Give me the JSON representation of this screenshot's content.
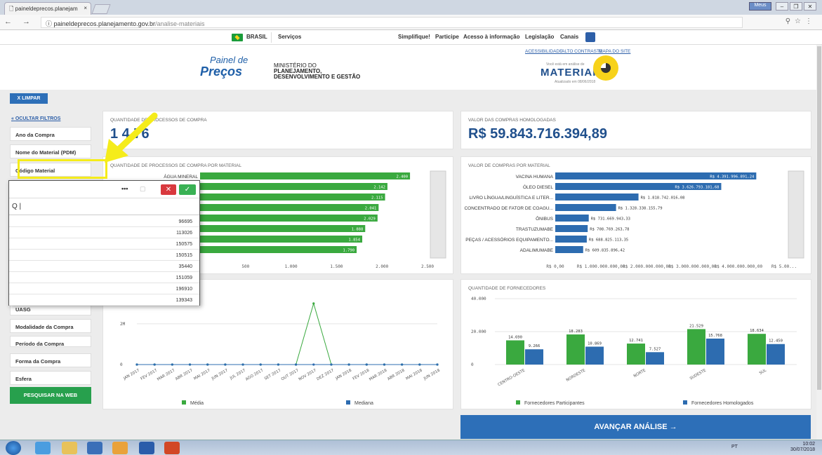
{
  "browser": {
    "tab_title": "paineldeprecos.planejam",
    "tab_close": "×",
    "url_host": "paineldeprecos.planejamento.gov.br",
    "url_path": "/analise-materiais",
    "profile": "Meus"
  },
  "govbar": {
    "brasil": "BRASIL",
    "servicos": "Serviços",
    "simplifique": "Simplifique!",
    "participe": "Participe",
    "acesso": "Acesso à informação",
    "legislacao": "Legislação",
    "canais": "Canais"
  },
  "header": {
    "logo_line1": "Painel de",
    "logo_line2": "Preços",
    "ministerio_1": "MINISTÉRIO DO",
    "ministerio_2": "PLANEJAMENTO,",
    "ministerio_3": "DESENVOLVIMENTO E GESTÃO",
    "acessibilidade": "ACESSIBILIDADE",
    "alto_contraste": "ALTO CONTRASTE",
    "mapa_do_site": "MAPA DO SITE",
    "voce_esta": "Você está em análise de",
    "materiais": "MATERIAIS",
    "atualizado": "Atualizado em 08/06/2018"
  },
  "limpar": "X  LIMPAR",
  "sidebar": {
    "ocultar": "OCULTAR FILTROS",
    "filters": {
      "ano": "Ano da Compra",
      "nome": "Nome do Material (PDM)",
      "codigo": "Código Material",
      "uasg": "UASG",
      "modalidade": "Modalidade da Compra",
      "periodo": "Período da Compra",
      "forma": "Forma da Compra",
      "esfera": "Esfera"
    },
    "pesquisar": "PESQUISAR NA WEB"
  },
  "dropdown": {
    "search_glyph": "Q |",
    "items": [
      "96695",
      "113026",
      "150575",
      "150515",
      "35440",
      "151059",
      "196910",
      "139343"
    ]
  },
  "kpi": {
    "processos_title": "QUANTIDADE DE PROCESSOS DE COMPRA",
    "processos_value_visible": "1  4  76",
    "valor_title": "VALOR DAS COMPRAS HOMOLOGADAS",
    "valor_value": "R$ 59.843.716.394,89"
  },
  "chart_data": [
    {
      "type": "bar",
      "title": "QUANTIDADE DE PROCESSOS DE COMPRA POR MATERIAL",
      "categories": [
        "ÁGUA MINERAL",
        "",
        "",
        "",
        "",
        "",
        "",
        ""
      ],
      "values": [
        2400,
        2142,
        2115,
        2041,
        2029,
        1888,
        1854,
        1790
      ],
      "value_labels": [
        "2.400",
        "2.142",
        "2.115",
        "2.041",
        "2.029",
        "1.888",
        "1.854",
        "1.790"
      ],
      "xlim": [
        0,
        2600
      ],
      "x_ticks": [
        "500",
        "1.000",
        "1.500",
        "2.000",
        "2.500"
      ],
      "color": "#3aa93f"
    },
    {
      "type": "bar",
      "title": "VALOR DE COMPRAS POR MATERIAL",
      "categories": [
        "VACINA HUMANA",
        "ÓLEO DIESEL",
        "LIVRO LÍNGUA/LINGUÍSTICA E LITER...",
        "CONCENTRADO DE FATOR DE COAGU...",
        "ÔNIBUS",
        "TRASTUZUMABE",
        "PEÇAS / ACESSÓRIOS EQUIPAMENTO...",
        "ADALIMUMABE"
      ],
      "values": [
        4391996891.24,
        3626793181.68,
        1818742016.08,
        1328338155.79,
        731669943.33,
        708769263.78,
        688825113.35,
        609835896.42
      ],
      "value_labels": [
        "R$ 4.391.996.891,24",
        "R$ 3.626.793.181,68",
        "R$ 1.818.742.016,08",
        "R$ 1.328.338.155,79",
        "R$ 731.669.943,33",
        "R$ 708.769.263,78",
        "R$ 688.825.113,35",
        "R$ 609.835.896,42"
      ],
      "xlim": [
        0,
        5000000000
      ],
      "x_ticks": [
        "R$ 0,00",
        "R$ 1.000.000.000,00",
        "R$ 2.000.000.000,00",
        "R$ 3.000.000.000,00",
        "R$ 4.000.000.000,00",
        "R$ 5.00..."
      ],
      "color": "#2d6cb0"
    },
    {
      "type": "line",
      "title": "",
      "categories": [
        "JAN 2017",
        "FEV 2017",
        "MAR 2017",
        "ABR 2017",
        "MAI 2017",
        "JUN 2017",
        "JUL 2017",
        "AGO 2017",
        "SET 2017",
        "OUT 2017",
        "NOV 2017",
        "DEZ 2017",
        "JAN 2018",
        "FEV 2018",
        "MAR 2018",
        "ABR 2018",
        "MAI 2018",
        "JUN 2018"
      ],
      "series": [
        {
          "name": "Média",
          "color": "#3aa93f",
          "values": [
            0,
            0,
            0,
            0,
            0,
            0,
            0,
            0,
            0,
            0,
            3000000,
            0,
            0,
            0,
            0,
            0,
            0,
            0
          ]
        },
        {
          "name": "Mediana",
          "color": "#2d6cb0",
          "values": [
            0,
            0,
            0,
            0,
            0,
            0,
            0,
            0,
            0,
            0,
            0,
            0,
            0,
            0,
            0,
            0,
            0,
            0
          ]
        }
      ],
      "ylim": [
        0,
        3200000
      ],
      "y_ticks": [
        "0",
        "2M"
      ],
      "partial_title": "O",
      "legend": "bottom"
    },
    {
      "type": "bar",
      "title": "QUANTIDADE DE FORNECEDORES",
      "categories": [
        "CENTRO-OESTE",
        "NORDESTE",
        "NORTE",
        "SUDESTE",
        "SUL"
      ],
      "series": [
        {
          "name": "Fornecedores Participantes",
          "color": "#3aa93f",
          "values": [
            14690,
            18283,
            12741,
            21529,
            18634
          ],
          "labels": [
            "14.690",
            "18.283",
            "12.741",
            "21.529",
            "18.634"
          ]
        },
        {
          "name": "Fornecedores Homologados",
          "color": "#2d6cb0",
          "values": [
            9266,
            10869,
            7527,
            15768,
            12450
          ],
          "labels": [
            "9.266",
            "10.869",
            "7.527",
            "15.768",
            "12.450"
          ]
        }
      ],
      "ylim": [
        0,
        40000
      ],
      "y_ticks": [
        "0",
        "20.000",
        "40.000"
      ],
      "legend": "bottom"
    }
  ],
  "avancar": "AVANÇAR ANÁLISE  →",
  "taskbar": {
    "lang": "PT",
    "time": "10:02",
    "date": "30/07/2018"
  }
}
